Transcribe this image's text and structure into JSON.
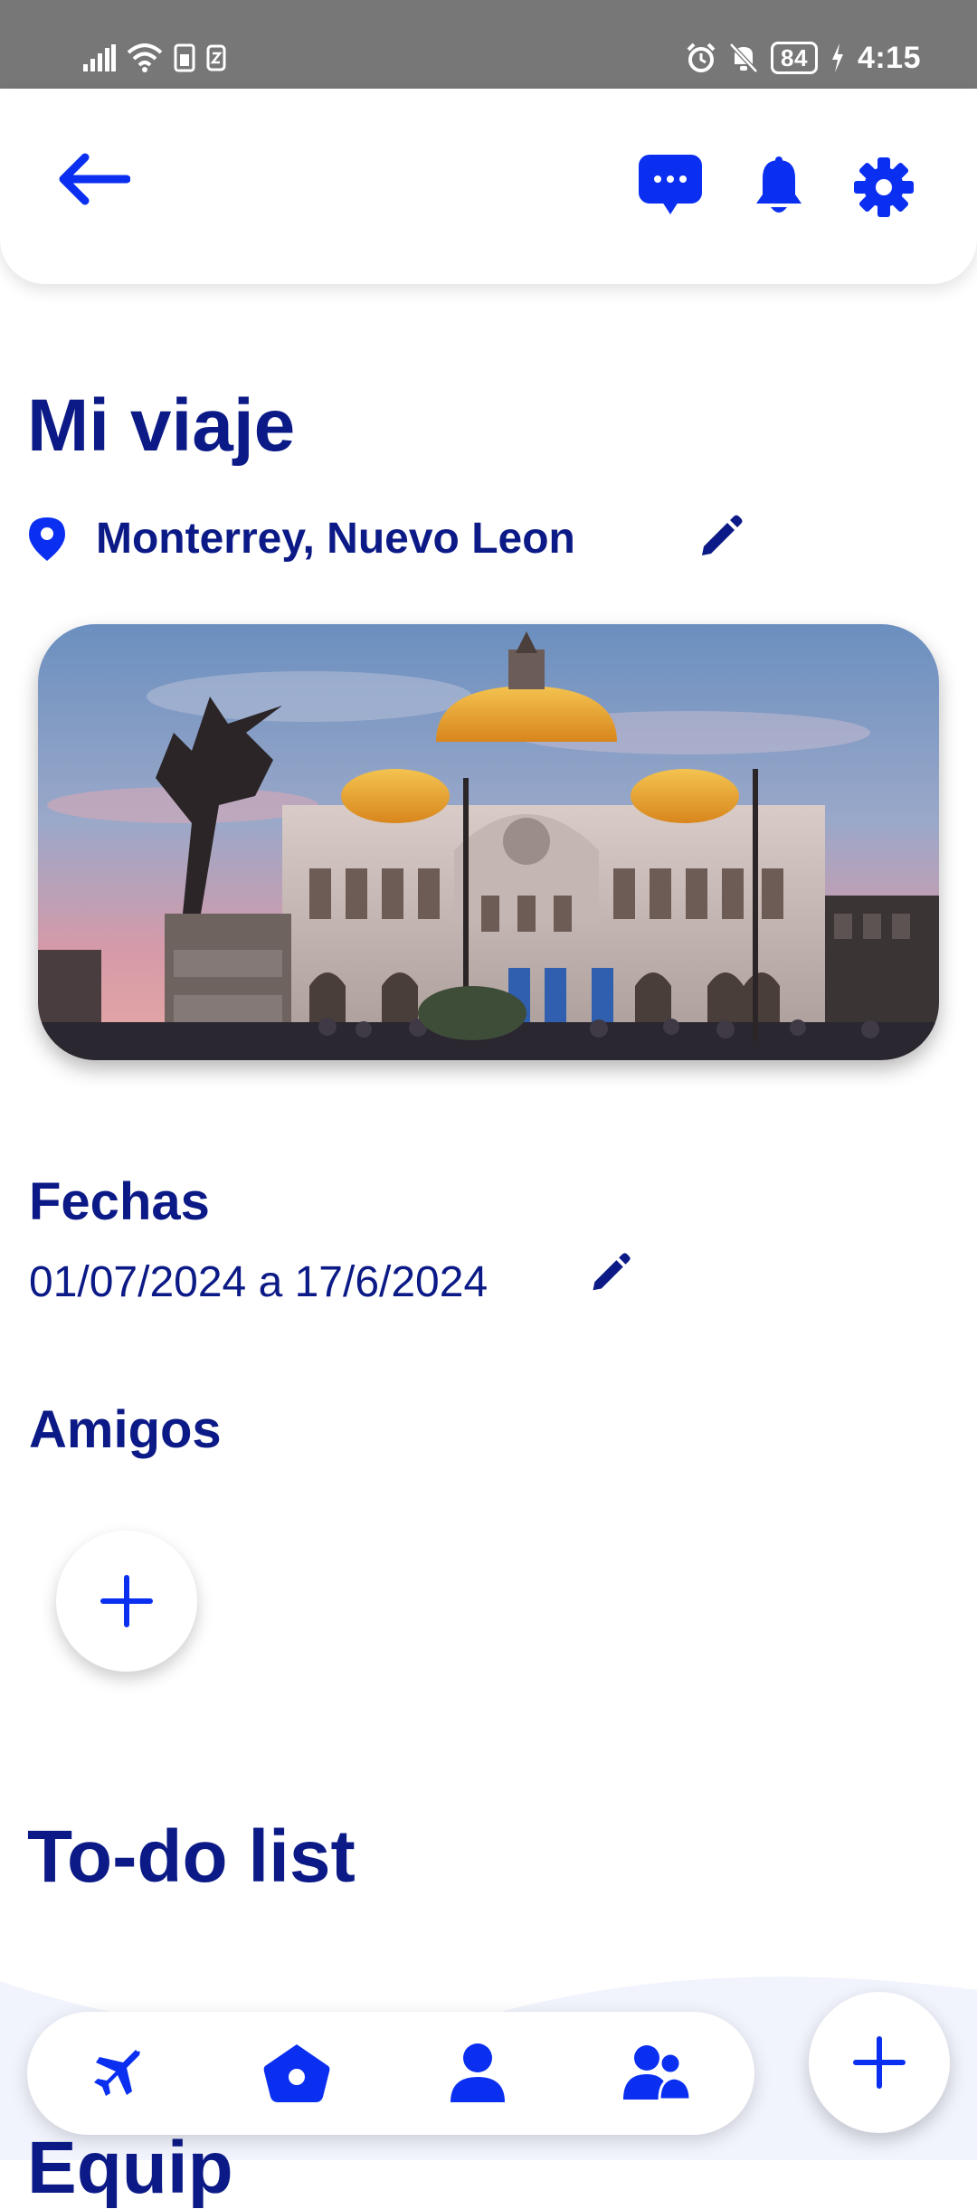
{
  "status_bar": {
    "time": "4:15",
    "battery": "84"
  },
  "header": {
    "back_icon": "arrow-left-icon",
    "chat_icon": "chat-bubble-icon",
    "notifications_icon": "bell-icon",
    "settings_icon": "gear-icon"
  },
  "trip": {
    "title": "Mi viaje",
    "location": "Monterrey, Nuevo Leon",
    "dates_label": "Fechas",
    "dates_value": "01/07/2024 a 17/6/2024",
    "friends_label": "Amigos",
    "todo_title": "To-do list",
    "next_section_partial": "Equip"
  },
  "nav": {
    "items": [
      {
        "icon": "airplane-icon"
      },
      {
        "icon": "home-icon"
      },
      {
        "icon": "person-icon"
      },
      {
        "icon": "group-icon"
      }
    ]
  },
  "colors": {
    "primary": "#0a2ff0",
    "text": "#0b1a86",
    "status_bar": "#777777"
  }
}
